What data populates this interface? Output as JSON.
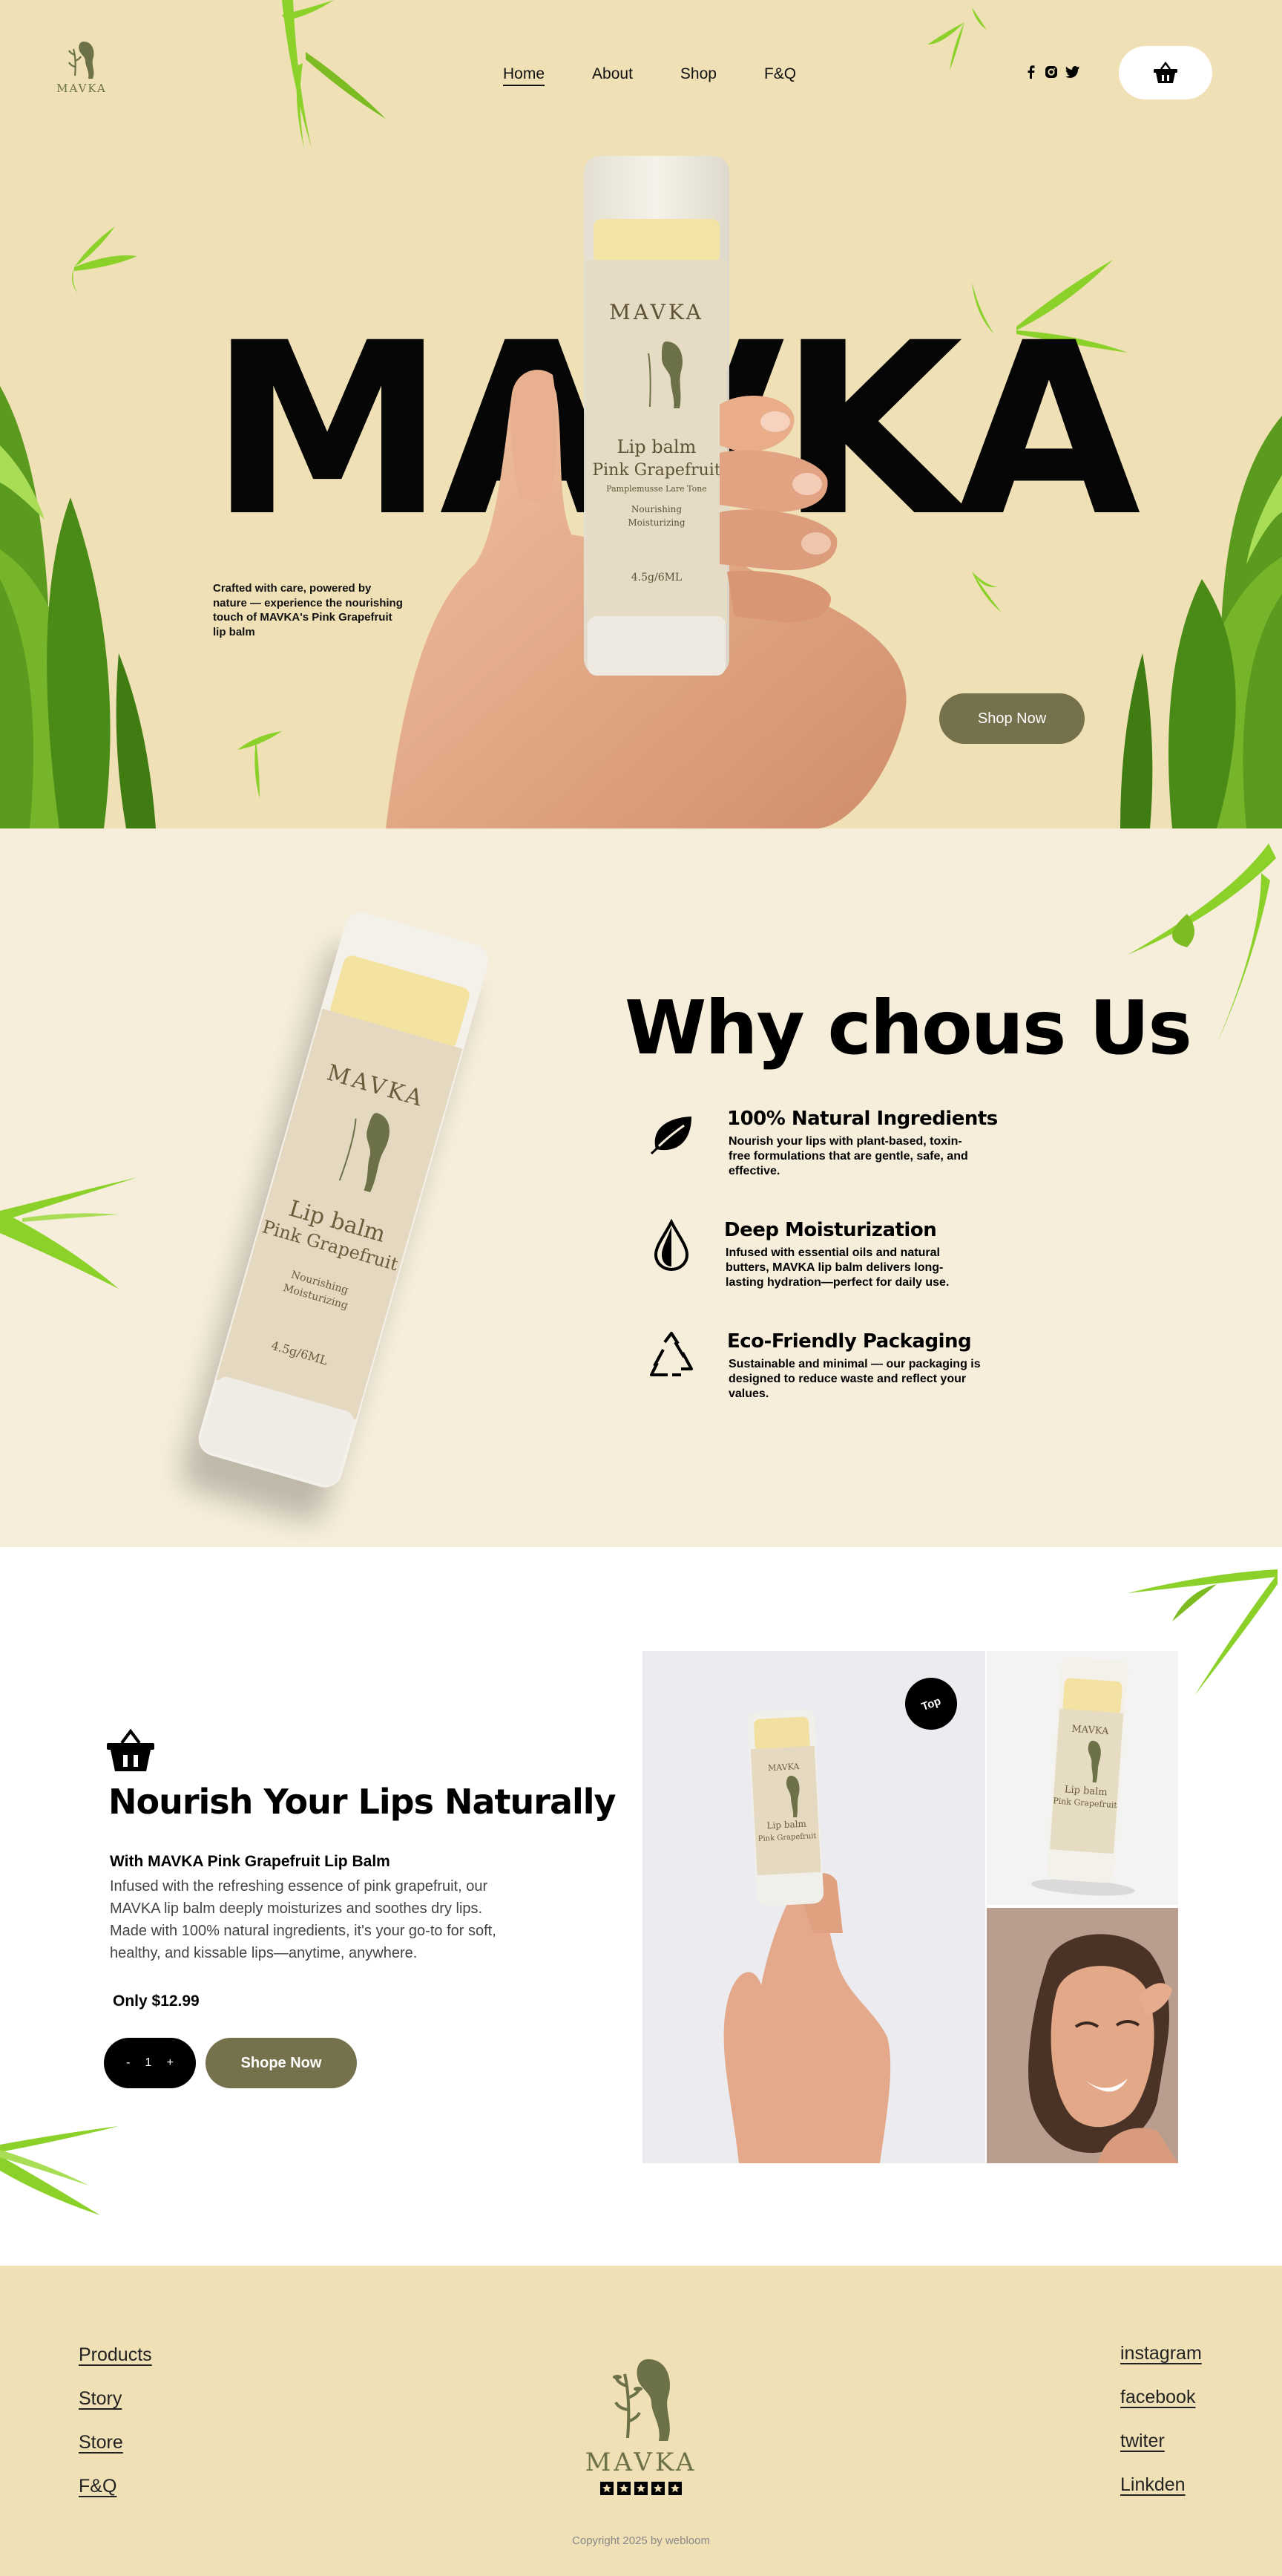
{
  "brand": {
    "name": "MAVKA"
  },
  "nav": {
    "items": [
      {
        "label": "Home",
        "active": true
      },
      {
        "label": "About"
      },
      {
        "label": "Shop"
      },
      {
        "label": "F&Q"
      }
    ],
    "social_icons": [
      "facebook-icon",
      "instagram-icon",
      "twitter-icon"
    ],
    "cart_icon": "basket-icon"
  },
  "hero": {
    "title": "MAVKA",
    "tagline": "Crafted with care, powered by nature — experience the nourishing touch of MAVKA's Pink Grapefruit lip balm",
    "cta": "Shop Now",
    "product_label": {
      "brand": "MAVKA",
      "line1": "Lip balm",
      "line2": "Pink Grapefruit",
      "line3": "Pamplemusse Lare Tone",
      "line4": "Nourishing",
      "line5": "Moisturizing",
      "size": "4.5g/6ML"
    }
  },
  "why": {
    "title": "Why chous Us",
    "features": [
      {
        "icon": "leaf-icon",
        "title": "100% Natural Ingredients",
        "text": "Nourish your lips with plant-based, toxin-free formulations that are gentle, safe, and effective."
      },
      {
        "icon": "drop-icon",
        "title": "Deep Moisturization",
        "text": "Infused with essential oils and natural butters, MAVKA lip balm delivers long-lasting hydration—perfect for daily use."
      },
      {
        "icon": "recycle-icon",
        "title": "Eco-Friendly Packaging",
        "text": "Sustainable and minimal — our packaging is designed to reduce waste and reflect your values."
      }
    ]
  },
  "product": {
    "title": "Nourish Your Lips Naturally",
    "subtitle": "With MAVKA Pink Grapefruit Lip Balm",
    "description": "Infused with the refreshing essence of pink grapefruit, our MAVKA lip balm deeply moisturizes and soothes dry lips. Made with 100% natural ingredients, it's your go-to for soft, healthy, and kissable lips—anytime, anywhere.",
    "price": "Only $12.99",
    "stepper": {
      "minus": "-",
      "value": "1",
      "plus": "+"
    },
    "cta": "Shope Now",
    "badge": "Top"
  },
  "footer": {
    "left_links": [
      "Products",
      "Story",
      "Store",
      "F&Q"
    ],
    "right_links": [
      "instagram",
      "facebook",
      "twiter",
      "Linkden"
    ],
    "logo_word": "MAVKA",
    "copyright": "Copyright 2025 by webloom"
  },
  "colors": {
    "hero_bg": "#efe0b6",
    "why_bg": "#f6eedb",
    "olive": "#75714d",
    "logo_green": "#6c7148",
    "leaf_green": "#7fc41f"
  }
}
